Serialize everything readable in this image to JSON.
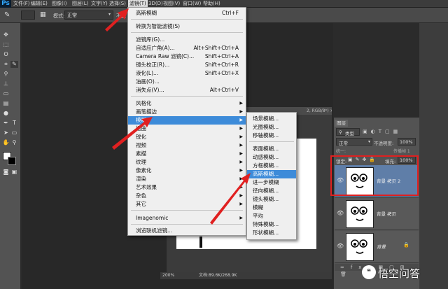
{
  "app": {
    "logo": "Ps"
  },
  "menubar": {
    "items": [
      "文件(F)",
      "编辑(E)",
      "图像(I)",
      "图层(L)",
      "文字(Y)",
      "选择(S)",
      "滤镜(T)",
      "3D(D)",
      "视图(V)",
      "窗口(W)",
      "帮助(H)"
    ],
    "active": "滤镜(T)"
  },
  "options": {
    "mode_label": "模式:",
    "mode_value": "正常",
    "opacity_label": "不透"
  },
  "filter_menu": {
    "items": [
      {
        "label": "高斯模糊",
        "shortcut": "Ctrl+F"
      },
      {
        "label": "转换为智能滤镜(S)",
        "shortcut": ""
      },
      {
        "label": "滤镜库(G)...",
        "shortcut": ""
      },
      {
        "label": "自适应广角(A)...",
        "shortcut": "Alt+Shift+Ctrl+A"
      },
      {
        "label": "Camera Raw 滤镜(C)...",
        "shortcut": "Shift+Ctrl+A"
      },
      {
        "label": "镜头校正(R)...",
        "shortcut": "Shift+Ctrl+R"
      },
      {
        "label": "液化(L)...",
        "shortcut": "Shift+Ctrl+X"
      },
      {
        "label": "油画(O)...",
        "shortcut": ""
      },
      {
        "label": "消失点(V)...",
        "shortcut": "Alt+Ctrl+V"
      },
      {
        "label": "风格化",
        "shortcut": ""
      },
      {
        "label": "画笔描边",
        "shortcut": ""
      },
      {
        "label": "模糊",
        "shortcut": ""
      },
      {
        "label": "扭曲",
        "shortcut": ""
      },
      {
        "label": "锐化",
        "shortcut": ""
      },
      {
        "label": "视频",
        "shortcut": ""
      },
      {
        "label": "素描",
        "shortcut": ""
      },
      {
        "label": "纹理",
        "shortcut": ""
      },
      {
        "label": "像素化",
        "shortcut": ""
      },
      {
        "label": "渲染",
        "shortcut": ""
      },
      {
        "label": "艺术效果",
        "shortcut": ""
      },
      {
        "label": "杂色",
        "shortcut": ""
      },
      {
        "label": "其它",
        "shortcut": ""
      },
      {
        "label": "Imagenomic",
        "shortcut": ""
      },
      {
        "label": "浏览联机滤镜...",
        "shortcut": ""
      }
    ]
  },
  "blur_menu": {
    "items": [
      "场景模糊...",
      "光圈模糊...",
      "移轴模糊...",
      "表面模糊...",
      "动感模糊...",
      "方框模糊...",
      "高斯模糊...",
      "进一步模糊",
      "径向模糊...",
      "镜头模糊...",
      "模糊",
      "平均",
      "特殊模糊...",
      "形状模糊..."
    ]
  },
  "document": {
    "title": "2, RGB/8*) ×",
    "zoom": "200%",
    "doc_info": "文档:89.6K/268.9K"
  },
  "layers": {
    "tab_label": "图层",
    "filter_label": "类型",
    "blend_mode": "正常",
    "opacity_label": "不透明度:",
    "opacity_value": "100%",
    "lock_label": "锁定:",
    "fill_label": "填充:",
    "fill_value": "100%",
    "unify_label": "统一:",
    "propagate_label": "传播帧 1",
    "items": [
      {
        "name": "背景 拷贝 2",
        "selected": true
      },
      {
        "name": "背景 拷贝",
        "selected": false
      },
      {
        "name": "背景",
        "selected": false
      }
    ]
  },
  "watermark": {
    "text": "悟空问答",
    "icon": "chat-bubble-icon"
  },
  "colors": {
    "highlight": "#3d8bd9",
    "annotation_red": "#e02020"
  }
}
